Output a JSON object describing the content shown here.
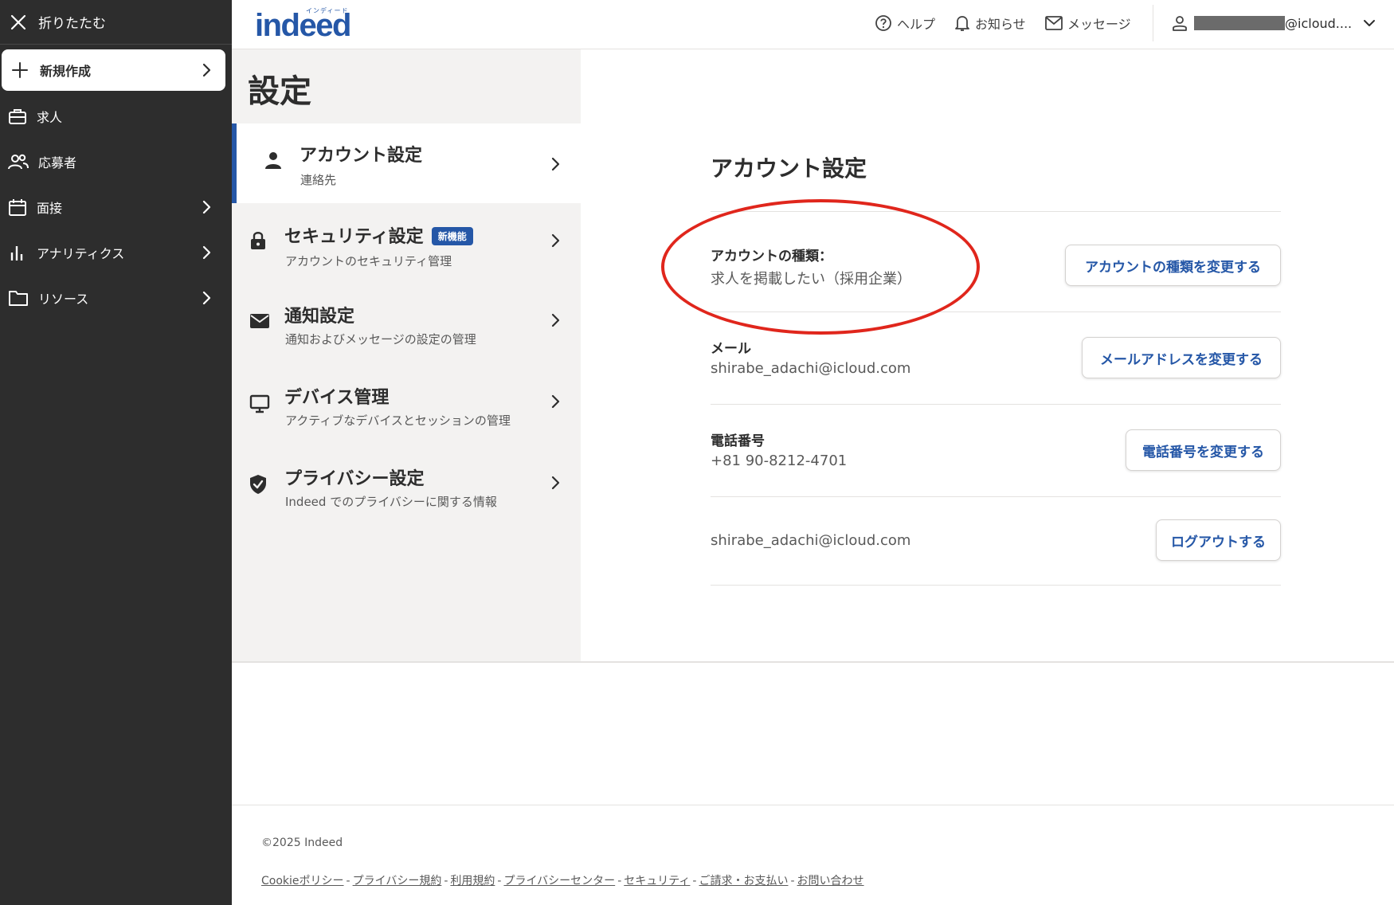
{
  "sidebar": {
    "collapse_label": "折りたたむ",
    "new_label": "新規作成",
    "items": [
      {
        "label": "求人"
      },
      {
        "label": "応募者"
      },
      {
        "label": "面接"
      },
      {
        "label": "アナリティクス"
      },
      {
        "label": "リソース"
      }
    ]
  },
  "header": {
    "logo_text": "indeed",
    "logo_kana": "インディード",
    "help": "ヘルプ",
    "notifications": "お知らせ",
    "messages": "メッセージ",
    "account_email": "@icloud...."
  },
  "settings_nav": {
    "title": "設定",
    "items": [
      {
        "title": "アカウント設定",
        "subtitle": "連絡先"
      },
      {
        "title": "セキュリティ設定",
        "subtitle": "アカウントのセキュリティ管理",
        "badge": "新機能"
      },
      {
        "title": "通知設定",
        "subtitle": "通知およびメッセージの設定の管理"
      },
      {
        "title": "デバイス管理",
        "subtitle": "アクティブなデバイスとセッションの管理"
      },
      {
        "title": "プライバシー設定",
        "subtitle": "Indeed でのプライバシーに関する情報"
      }
    ]
  },
  "account": {
    "title": "アカウント設定",
    "type_label": "アカウントの種類：",
    "type_value": "求人を掲載したい（採用企業）",
    "type_button": "アカウントの種類を変更する",
    "email_label": "メール",
    "email_value": "shirabe_adachi@icloud.com",
    "email_button": "メールアドレスを変更する",
    "phone_label": "電話番号",
    "phone_value": "+81 90-8212-4701",
    "phone_button": "電話番号を変更する",
    "logout_email": "shirabe_adachi@icloud.com",
    "logout_button": "ログアウトする"
  },
  "footer": {
    "copyright": "©2025 Indeed",
    "links": [
      "Cookieポリシー",
      "プライバシー規約",
      "利用規約",
      "プライバシーセンター",
      "セキュリティ",
      "ご請求・お支払い",
      "お問い合わせ"
    ],
    "separator": "-"
  },
  "colors": {
    "sidebar_bg": "#2d2d2d",
    "brand_blue": "#2557a7",
    "annotation_red": "#e0261c",
    "nav_panel_bg": "#f3f2f1"
  }
}
